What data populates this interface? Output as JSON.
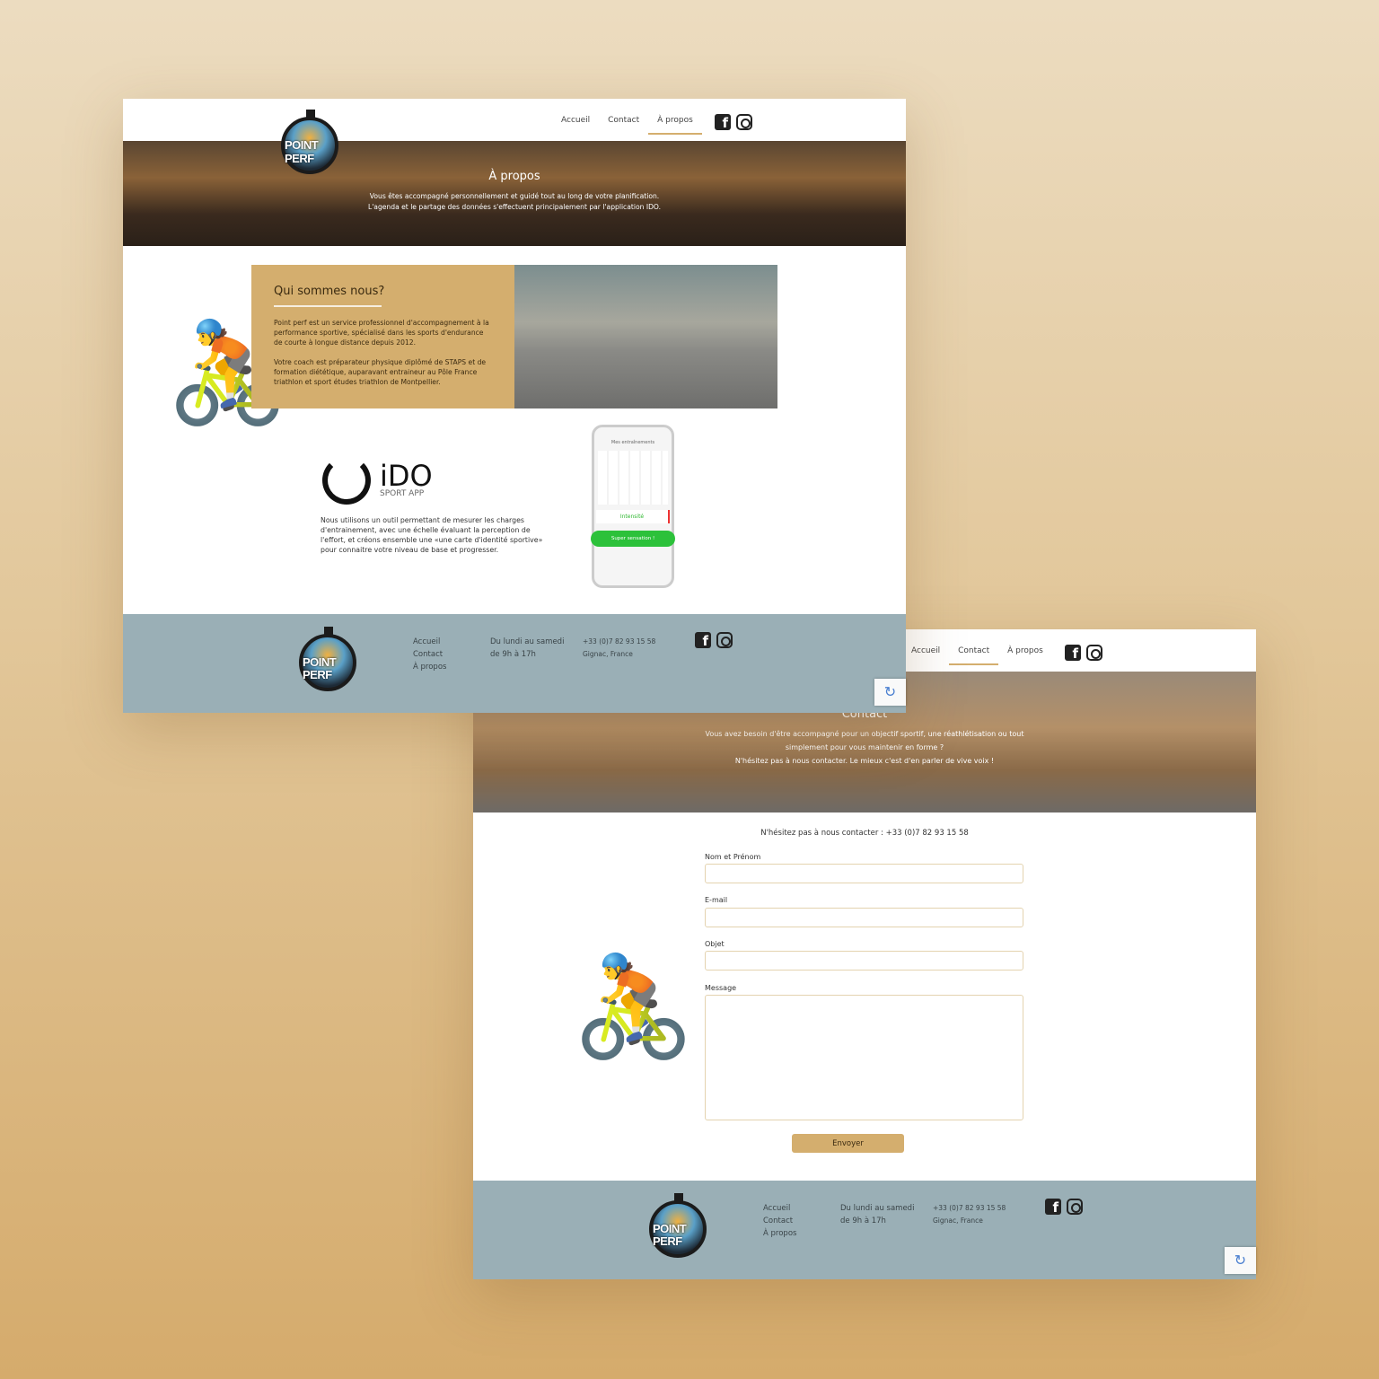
{
  "brand": {
    "logo_text": "POINT PERF"
  },
  "nav": {
    "items": [
      "Accueil",
      "Contact",
      "À propos"
    ]
  },
  "about_page": {
    "hero_title": "À propos",
    "hero_text": [
      "Vous êtes accompagné personnellement et guidé tout au long de votre planification.",
      "L'agenda et le partage des données s'effectuent principalement par l'application IDO."
    ],
    "card_title": "Qui sommes nous?",
    "card_paragraphs": [
      "Point perf est un service professionnel d'accompagnement à la performance sportive, spécialisé dans les sports d'endurance de courte à longue distance depuis 2012.",
      "Votre coach est préparateur physique diplômé de STAPS et de formation diététique, auparavant entraineur au Pôle France triathlon et sport études triathlon de Montpellier."
    ],
    "ido_name": "iDO",
    "ido_sub": "SPORT APP",
    "ido_text": "Nous utilisons un outil permettant de mesurer les charges d'entrainement, avec une échelle évaluant la perception de l'effort, et créons ensemble une «une carte d'identité sportive» pour connaitre votre niveau de base et progresser.",
    "phone": {
      "title": "Mes entraînements",
      "card1": "Intensité",
      "card2": "Super sensation !"
    }
  },
  "contact_page": {
    "hero_title": "Contact",
    "hero_text": [
      "Vous avez besoin d'être accompagné pour un objectif sportif, une réathlétisation ou tout",
      "simplement pour vous maintenir en forme ?",
      "N'hésitez pas à nous contacter. Le mieux c'est d'en parler de vive voix !"
    ],
    "intro": "N'hésitez pas à nous contacter : +33 (0)7 82 93 15 58",
    "fields": [
      "Nom et Prénom",
      "E-mail",
      "Objet",
      "Message"
    ],
    "submit": "Envoyer"
  },
  "footer": {
    "links": [
      "Accueil",
      "Contact",
      "À propos"
    ],
    "hours": [
      "Du lundi au samedi",
      "de 9h à 17h"
    ],
    "contact": [
      "+33 (0)7 82 93 15 58",
      "Gignac, France"
    ]
  },
  "colors": {
    "accent": "#d4ae6e",
    "footer": "#9aafb6"
  }
}
